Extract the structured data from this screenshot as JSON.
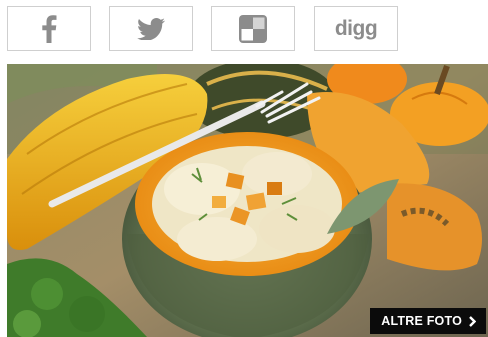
{
  "share": {
    "buttons": [
      {
        "icon": "facebook-icon"
      },
      {
        "icon": "twitter-icon"
      },
      {
        "icon": "delicious-icon"
      },
      {
        "icon": "digg-icon",
        "label": "digg"
      }
    ]
  },
  "gallery": {
    "image": "pumpkin-ravioli-photo",
    "more_photos_label": "ALTRE FOTO",
    "more_photos_icon": "chevron-right-icon"
  },
  "colors": {
    "icon_gray": "#8c8c8c",
    "border": "#cfcfcf",
    "overlay_button": "#0b0b0b",
    "pumpkin_orange": "#f5a623"
  }
}
